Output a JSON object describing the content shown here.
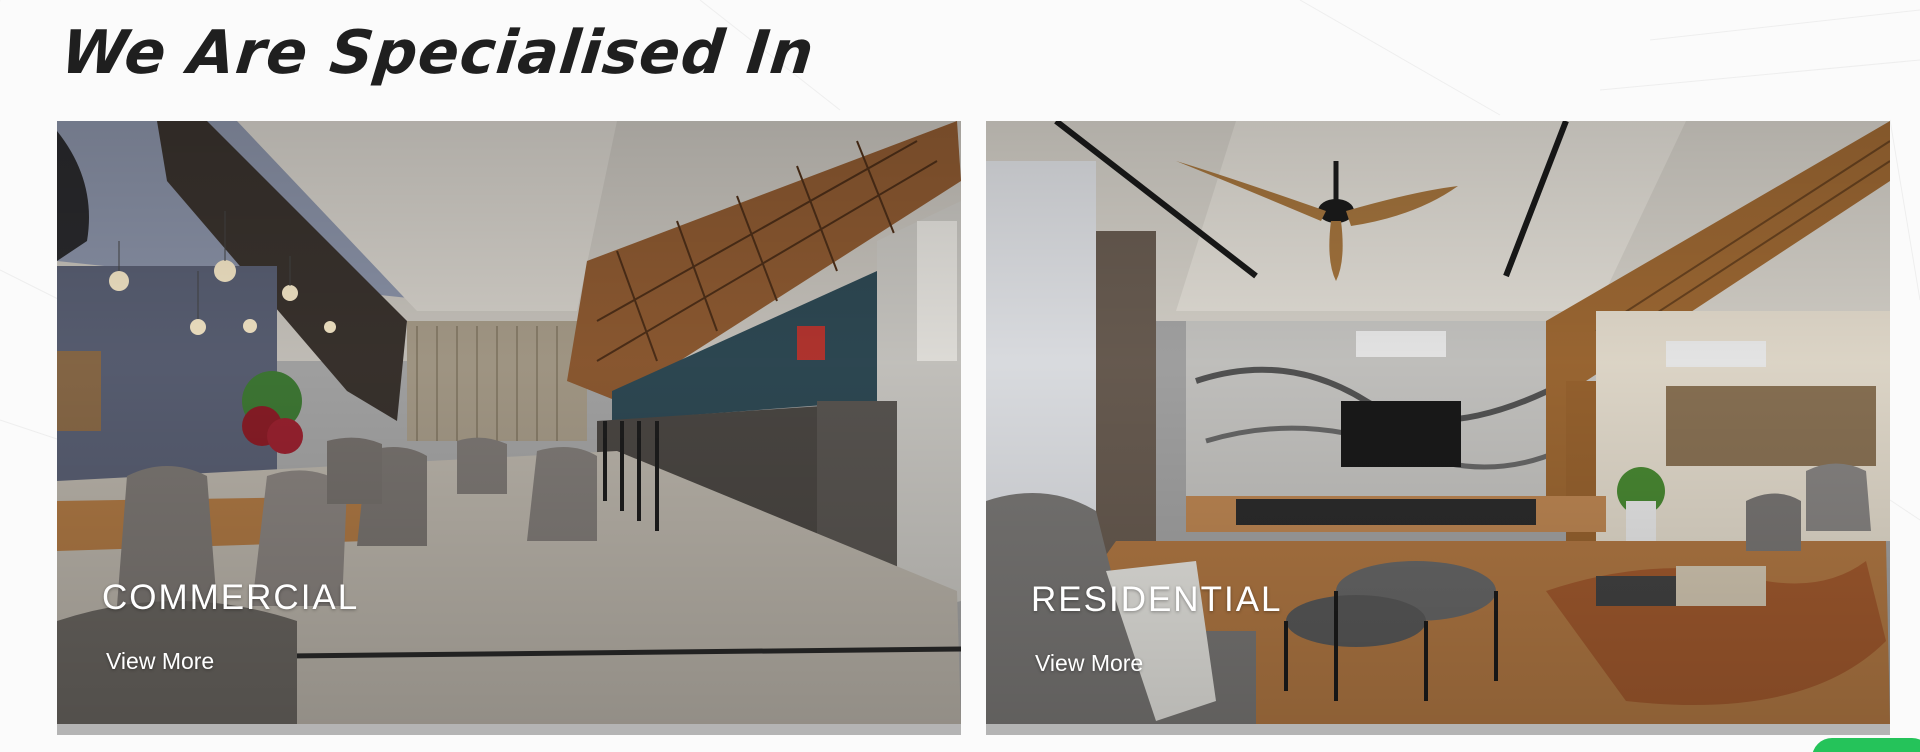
{
  "section": {
    "heading": "We Are Specialised In"
  },
  "cards": [
    {
      "title": "COMMERCIAL",
      "link_label": "View More",
      "image": "restaurant-interior"
    },
    {
      "title": "RESIDENTIAL",
      "link_label": "View More",
      "image": "living-room-interior"
    }
  ],
  "colors": {
    "heading": "#1f1f1f",
    "card_text": "#ffffff",
    "chat_accent": "#25c35a"
  }
}
